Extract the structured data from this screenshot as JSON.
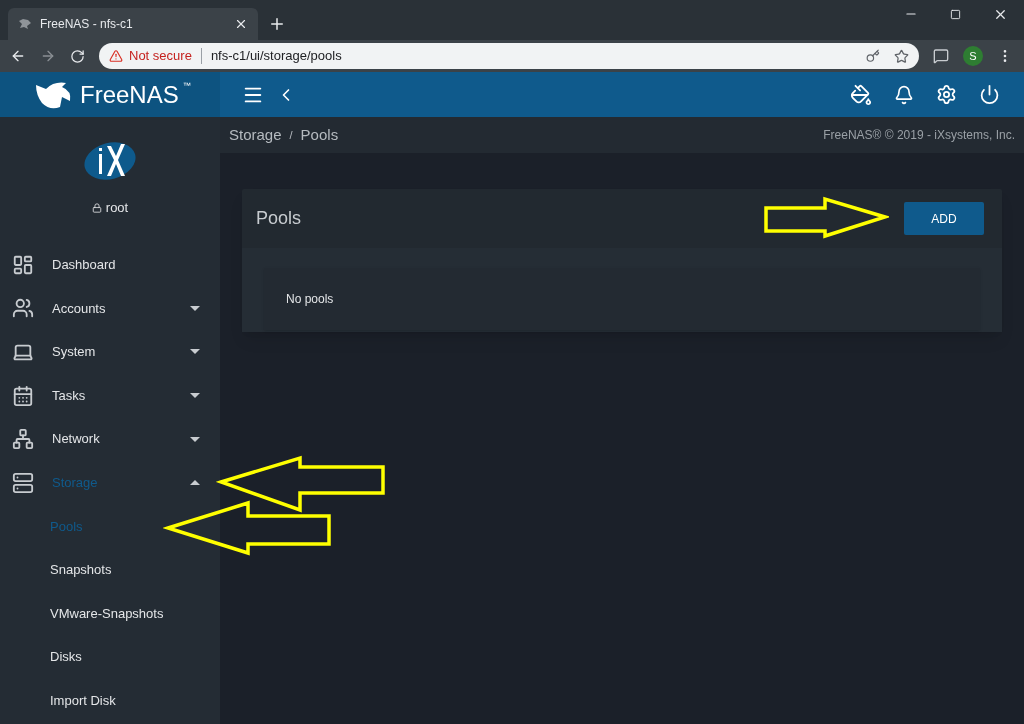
{
  "browser": {
    "tab_title": "FreeNAS - nfs-c1",
    "security_label": "Not secure",
    "url": "nfs-c1/ui/storage/pools",
    "profile_letter": "S"
  },
  "app_bar": {
    "logo_text": "FreeNAS",
    "logo_mark": "™"
  },
  "breadcrumb": {
    "items": [
      "Storage",
      "Pools"
    ],
    "separator": "/"
  },
  "copyright": "FreeNAS® © 2019 - iXsystems, Inc.",
  "user": {
    "name": "root"
  },
  "sidebar": {
    "items": [
      {
        "label": "Dashboard",
        "selected": false
      },
      {
        "label": "Accounts",
        "selected": false,
        "expanded": false
      },
      {
        "label": "System",
        "selected": false,
        "expanded": false
      },
      {
        "label": "Tasks",
        "selected": false,
        "expanded": false
      },
      {
        "label": "Network",
        "selected": false,
        "expanded": false
      },
      {
        "label": "Storage",
        "selected": true,
        "expanded": true,
        "children": [
          {
            "label": "Pools",
            "selected": true
          },
          {
            "label": "Snapshots",
            "selected": false
          },
          {
            "label": "VMware-Snapshots",
            "selected": false
          },
          {
            "label": "Disks",
            "selected": false
          },
          {
            "label": "Import Disk",
            "selected": false
          }
        ]
      }
    ]
  },
  "card": {
    "title": "Pools",
    "button": "ADD",
    "empty_text": "No pools"
  }
}
